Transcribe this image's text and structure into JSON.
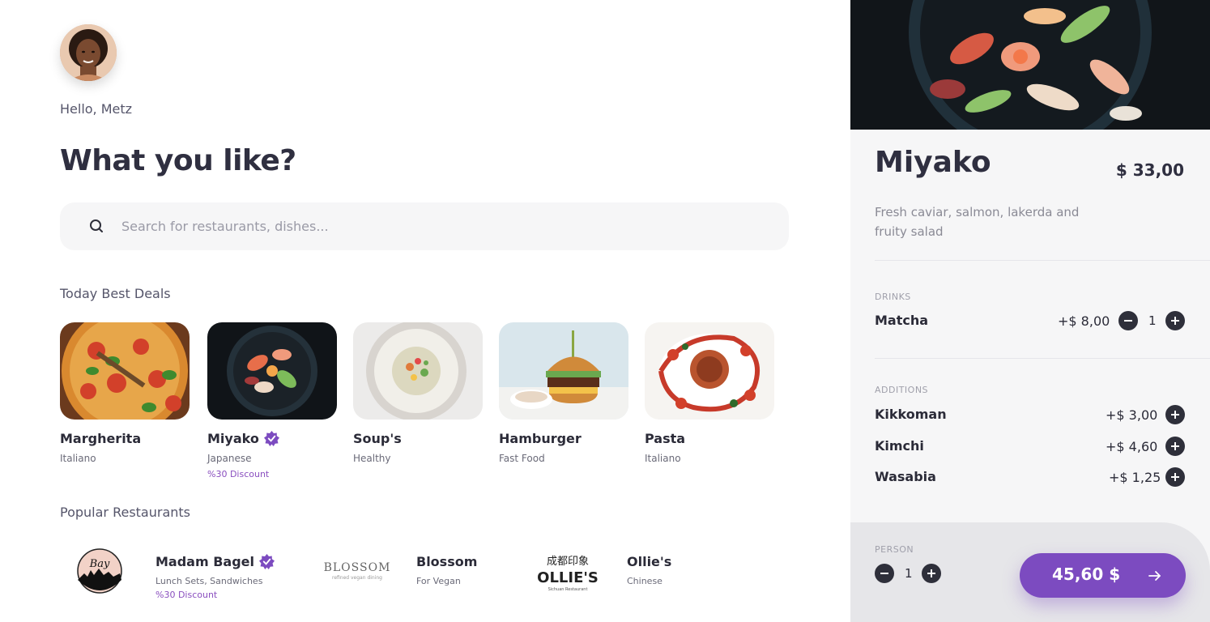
{
  "user": {
    "greeting": "Hello, Metz"
  },
  "headline": "What you like?",
  "search": {
    "placeholder": "Search for restaurants, dishes..."
  },
  "deals": {
    "title": "Today Best Deals",
    "items": [
      {
        "name": "Margherita",
        "category": "Italiano",
        "discount": ""
      },
      {
        "name": "Miyako",
        "category": "Japanese",
        "discount": "%30 Discount",
        "verified": true
      },
      {
        "name": "Soup's",
        "category": "Healthy",
        "discount": ""
      },
      {
        "name": "Hamburger",
        "category": "Fast Food",
        "discount": ""
      },
      {
        "name": "Pasta",
        "category": "Italiano",
        "discount": ""
      }
    ]
  },
  "restaurants": {
    "title": "Popular Restaurants",
    "items": [
      {
        "name": "Madam Bagel",
        "subtitle": "Lunch Sets, Sandwiches",
        "discount": "%30 Discount",
        "verified": true,
        "logo_text": "Bay",
        "logo_caption": "bagel & restaurant"
      },
      {
        "name": "Blossom",
        "subtitle": "For Vegan",
        "logo_text": "BLOSSOM",
        "logo_caption": "refined vegan dining"
      },
      {
        "name": "Ollie's",
        "subtitle": "Chinese",
        "logo_text": "OLLIE'S",
        "logo_top": "成都印象",
        "logo_caption": "Sichuan Restaurant"
      }
    ]
  },
  "detail": {
    "title": "Miyako",
    "price": "$ 33,00",
    "description": "Fresh caviar, salmon, lakerda and fruity salad",
    "drinks": {
      "label": "DRINKS",
      "items": [
        {
          "name": "Matcha",
          "price": "+$ 8,00",
          "qty": "1"
        }
      ]
    },
    "additions": {
      "label": "ADDITIONS",
      "items": [
        {
          "name": "Kikkoman",
          "price": "+$ 3,00"
        },
        {
          "name": "Kimchi",
          "price": "+$ 4,60"
        },
        {
          "name": "Wasabia",
          "price": "+$ 1,25"
        }
      ]
    },
    "person": {
      "label": "PERSON",
      "qty": "1"
    },
    "total": "45,60 $"
  },
  "colors": {
    "accent": "#7c4bc0",
    "dark": "#2e2f3a",
    "panel": "#f6f6f7"
  }
}
